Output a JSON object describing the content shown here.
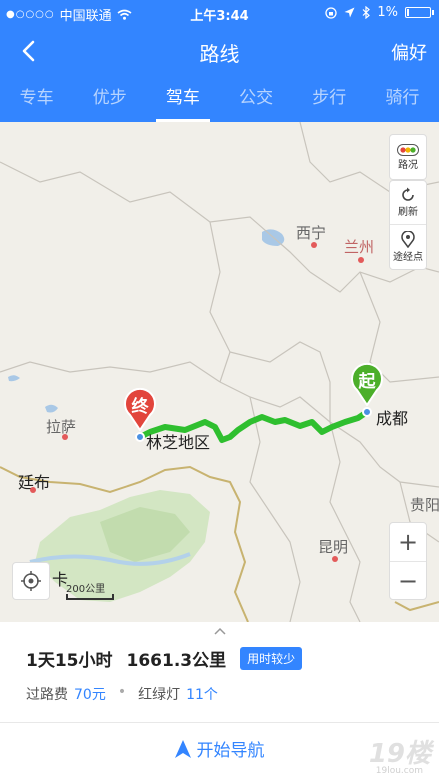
{
  "status_bar": {
    "carrier": "中国联通",
    "time": "上午3:44",
    "battery": "1%"
  },
  "nav": {
    "title": "路线",
    "preference": "偏好"
  },
  "tabs": [
    {
      "label": "专车",
      "active": false
    },
    {
      "label": "优步",
      "active": false
    },
    {
      "label": "驾车",
      "active": true
    },
    {
      "label": "公交",
      "active": false
    },
    {
      "label": "步行",
      "active": false
    },
    {
      "label": "骑行",
      "active": false
    }
  ],
  "map": {
    "places": {
      "xining": "西宁",
      "lanzhou": "兰州",
      "lhasa": "拉萨",
      "chengdu": "成都",
      "nyingchi": "林芝地区",
      "tingbu": "廷布",
      "kunming": "昆明",
      "guiyang": "贵阳",
      "ka": "卡"
    },
    "controls": {
      "traffic": "路况",
      "refresh": "刷新",
      "waypoint": "途经点"
    },
    "zoom_in": "+",
    "zoom_out": "−",
    "scale": "200公里",
    "start_marker": "起",
    "end_marker": "终",
    "colors": {
      "route": "#2fbf2f",
      "start": "#4caf2a",
      "end": "#e2453c",
      "accent": "#3385ff"
    }
  },
  "route": {
    "duration": "1天15小时",
    "distance": "1661.3公里",
    "badge": "用时较少",
    "toll_label": "过路费",
    "toll_value": "70元",
    "lights_label": "红绿灯",
    "lights_value": "11个"
  },
  "action": {
    "start_navigation": "开始导航"
  },
  "watermark": {
    "logo": "19楼",
    "domain": "19lou.com"
  }
}
